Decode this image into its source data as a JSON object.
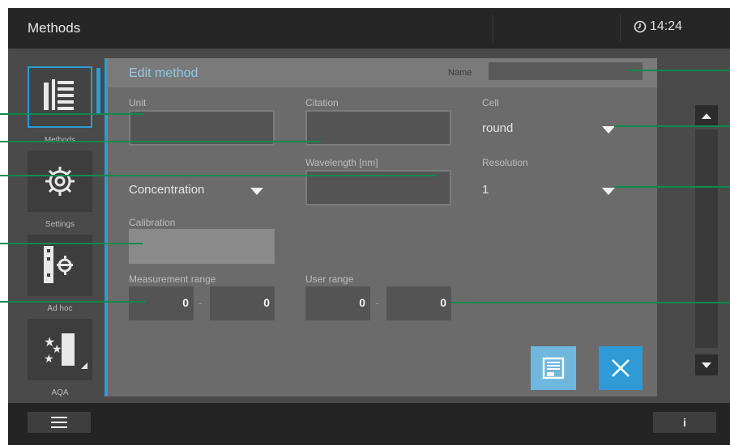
{
  "header": {
    "title": "Methods",
    "time": "14:24",
    "clock_icon": "clock-icon"
  },
  "sidebar": {
    "items": [
      {
        "label": "Methods",
        "icon": "methods-list-icon",
        "active": true
      },
      {
        "label": "Settings",
        "icon": "gear-icon",
        "active": false
      },
      {
        "label": "Ad hoc",
        "icon": "adhoc-icon",
        "active": false
      },
      {
        "label": "AQA",
        "icon": "aqa-stars-icon",
        "active": false
      }
    ]
  },
  "panel": {
    "title": "Edit method",
    "name_label": "Name",
    "name_value": "",
    "unit": {
      "label": "Unit",
      "value": ""
    },
    "citation": {
      "label": "Citation",
      "value": ""
    },
    "cell": {
      "label": "Cell",
      "value": "round"
    },
    "mode": {
      "value": "Concentration"
    },
    "wavelength": {
      "label": "Wavelength [nm]",
      "value": ""
    },
    "resolution": {
      "label": "Resolution",
      "value": "1"
    },
    "calibration": {
      "label": "Calibration",
      "value": ""
    },
    "measurement_range": {
      "label": "Measurement range",
      "from": "0",
      "sep": "-",
      "to": "0"
    },
    "user_range": {
      "label": "User range",
      "from": "0",
      "sep": "-",
      "to": "0"
    }
  },
  "colors": {
    "accent": "#2e9bd6",
    "callout": "#0d8a4e",
    "panel": "#6b6b6b",
    "topbar": "#262626"
  },
  "footer": {
    "menu_icon": "hamburger-icon",
    "info_label": "i"
  }
}
